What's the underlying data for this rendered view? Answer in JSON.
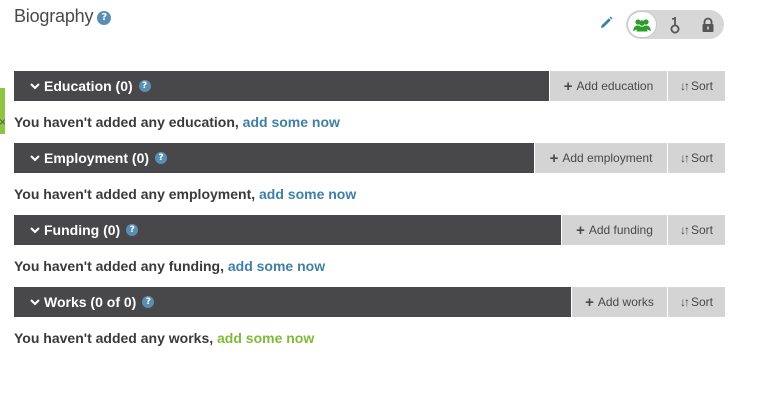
{
  "biography": {
    "title": "Biography",
    "help_glyph": "?"
  },
  "icons": {
    "pencil": "pencil-icon",
    "privacy_everyone": "group-icon",
    "privacy_trusted": "key-icon",
    "privacy_private": "lock-icon"
  },
  "colors": {
    "header_bar": "#48484b",
    "button_bg": "#d4d4d4",
    "link_blue": "#3f7fa6",
    "link_green": "#7fba38",
    "privacy_active": "#2e9e2b"
  },
  "sections": [
    {
      "title": "Education (0)",
      "add_label": "Add education",
      "sort_label": "Sort",
      "empty_text": "You haven't added any education,",
      "link_text": "add some now"
    },
    {
      "title": "Employment (0)",
      "add_label": "Add employment",
      "sort_label": "Sort",
      "empty_text": "You haven't added any employment,",
      "link_text": "add some now"
    },
    {
      "title": "Funding (0)",
      "add_label": "Add funding",
      "sort_label": "Sort",
      "empty_text": "You haven't added any funding,",
      "link_text": "add some now"
    },
    {
      "title": "Works (0 of 0)",
      "add_label": "Add works",
      "sort_label": "Sort",
      "empty_text": "You haven't added any works,",
      "link_text": "add some now"
    }
  ]
}
